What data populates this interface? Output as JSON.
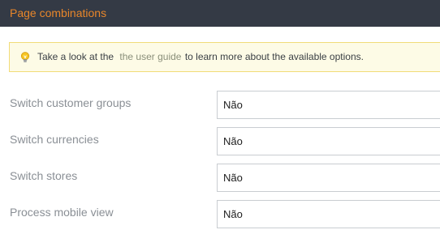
{
  "header": {
    "title": "Page combinations"
  },
  "tip": {
    "icon": "lightbulb-icon",
    "text_before": "Take a look at the",
    "link_text": "the user guide",
    "text_after": "to learn more about the available options."
  },
  "settings": [
    {
      "label": "Switch customer groups",
      "value": "Não"
    },
    {
      "label": "Switch currencies",
      "value": "Não"
    },
    {
      "label": "Switch stores",
      "value": "Não"
    },
    {
      "label": "Process mobile view",
      "value": "Não"
    }
  ],
  "colors": {
    "header_bg": "#343a45",
    "header_text": "#e8862a",
    "tip_bg": "#fdfbe6",
    "tip_border": "#f1dc78"
  }
}
